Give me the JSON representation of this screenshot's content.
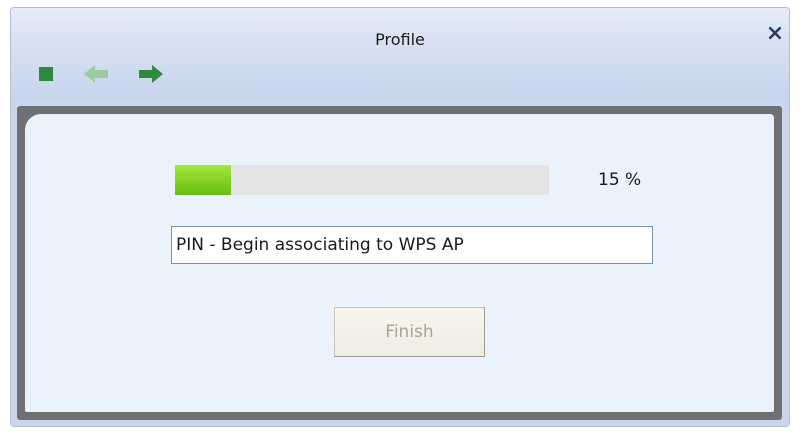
{
  "window": {
    "title": "Profile",
    "close_label": "×"
  },
  "toolbar": {
    "icons": [
      "stop-icon",
      "back-arrow-icon",
      "forward-arrow-icon"
    ],
    "colors": {
      "stop": "#2f8a3e",
      "back_disabled": "#9ccb9c",
      "forward": "#2f8a3e"
    }
  },
  "progress": {
    "percent": 15,
    "label": "15 %",
    "fill_color": "#7fce1e"
  },
  "status": {
    "value": "PIN - Begin associating to WPS AP"
  },
  "actions": {
    "finish_label": "Finish",
    "finish_enabled": false
  }
}
